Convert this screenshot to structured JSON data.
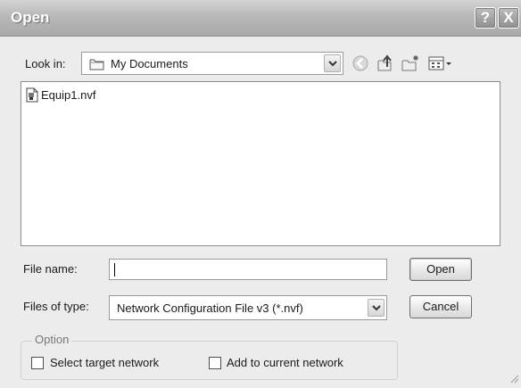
{
  "window": {
    "title": "Open"
  },
  "titlebar": {
    "help_icon": "help-icon",
    "close_icon": "close-icon",
    "help_glyph": "?",
    "close_glyph": "X"
  },
  "look_in": {
    "label": "Look in:",
    "value": "My Documents",
    "icon": "folder-icon"
  },
  "toolbar": {
    "icons": [
      "back-arrow-icon",
      "up-folder-icon",
      "new-folder-icon",
      "views-menu-icon"
    ]
  },
  "file_list": {
    "items": [
      {
        "name": "Equip1.nvf",
        "icon": "nvf-file-icon"
      }
    ]
  },
  "file_name": {
    "label": "File name:",
    "value": ""
  },
  "file_type": {
    "label": "Files of type:",
    "value": "Network Configuration File v3 (*.nvf)"
  },
  "buttons": {
    "open": "Open",
    "cancel": "Cancel"
  },
  "option_group": {
    "title": "Option",
    "select_target_label": "Select target network",
    "select_target_checked": false,
    "add_current_label": "Add to current network",
    "add_current_checked": false
  },
  "colors": {
    "titlebar": "#b8b8b8",
    "dialog_bg": "#ececec",
    "field_bg": "#ffffff"
  }
}
